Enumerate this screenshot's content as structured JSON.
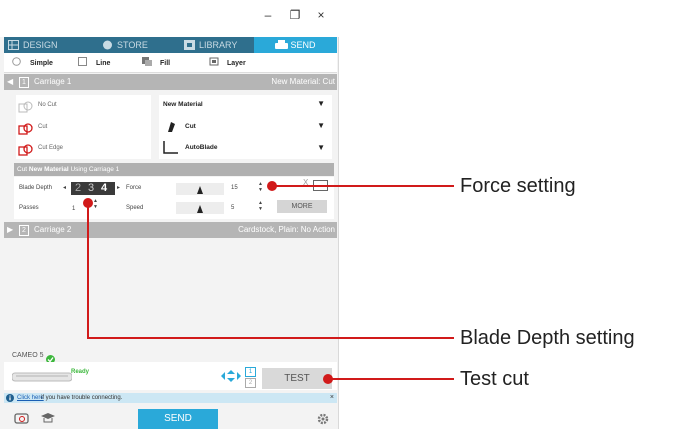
{
  "window": {
    "minimize": "–",
    "maximize": "❐",
    "close": "×"
  },
  "nav": {
    "tabs": [
      {
        "label": "DESIGN",
        "icon": "grid-icon"
      },
      {
        "label": "STORE",
        "icon": "store-icon"
      },
      {
        "label": "LIBRARY",
        "icon": "library-icon"
      },
      {
        "label": "SEND",
        "icon": "cutter-icon",
        "active": true
      }
    ]
  },
  "modes": [
    {
      "label": "Simple"
    },
    {
      "label": "Line"
    },
    {
      "label": "Fill"
    },
    {
      "label": "Layer"
    }
  ],
  "carriage1": {
    "number": "1",
    "label": "Carriage 1",
    "material": "New Material: Cut"
  },
  "cut_options": [
    "No Cut",
    "Cut",
    "Cut Edge"
  ],
  "material_settings": {
    "material": "New Material",
    "action": "Cut",
    "tool": "AutoBlade"
  },
  "cut_header": {
    "prefix": "Cut ",
    "material": "New Material",
    "suffix": " Using Carriage 1"
  },
  "settings": {
    "blade_depth_label": "Blade Depth",
    "blade_depth_values": [
      "2",
      "3",
      "4"
    ],
    "passes_label": "Passes",
    "passes_value": "1",
    "force_label": "Force",
    "force_value": "15",
    "speed_label": "Speed",
    "speed_value": "5",
    "more_label": "MORE",
    "x_label": "X"
  },
  "carriage2": {
    "number": "2",
    "label": "Carriage 2",
    "material": "Cardstock, Plain: No Action"
  },
  "device": {
    "name": "CAMEO 5",
    "status": "Ready",
    "carriage_1": "1",
    "carriage_2": "2",
    "test_label": "TEST"
  },
  "notice": {
    "link": "Click here",
    "text": " if you have trouble connecting.",
    "close": "×"
  },
  "bottom": {
    "send_label": "SEND"
  },
  "callouts": {
    "force": "Force setting",
    "blade": "Blade Depth setting",
    "test": "Test cut"
  },
  "colors": {
    "nav": "#2f6f8d",
    "accent": "#2aa9d9",
    "callout": "#d11a1a",
    "ready": "#3cb73c"
  }
}
